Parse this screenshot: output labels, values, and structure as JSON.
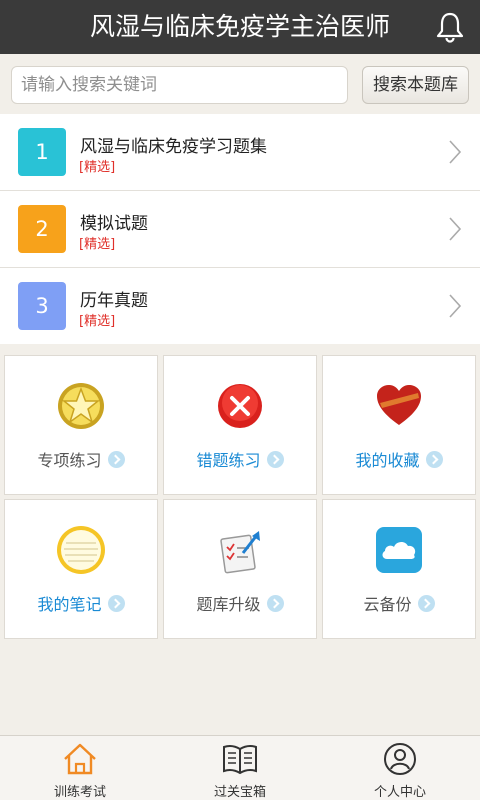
{
  "header": {
    "title": "风湿与临床免疫学主治医师",
    "bell_icon": "bell-icon"
  },
  "search": {
    "placeholder": "请输入搜索关键词",
    "button_label": "搜索本题库"
  },
  "list": {
    "items": [
      {
        "number": "1",
        "name": "风湿与临床免疫学习题集",
        "tag": "[精选]",
        "color": "#29c2d6"
      },
      {
        "number": "2",
        "name": "模拟试题",
        "tag": "[精选]",
        "color": "#f7a21b"
      },
      {
        "number": "3",
        "name": "历年真题",
        "tag": "[精选]",
        "color": "#7f9ff5"
      }
    ]
  },
  "grid": {
    "cells": [
      {
        "label": "专项练习",
        "icon": "star-badge-icon",
        "highlight": false
      },
      {
        "label": "错题练习",
        "icon": "wrong-x-icon",
        "highlight": true
      },
      {
        "label": "我的收藏",
        "icon": "heart-icon",
        "highlight": true
      },
      {
        "label": "我的笔记",
        "icon": "notepad-icon",
        "highlight": true
      },
      {
        "label": "题库升级",
        "icon": "upgrade-icon",
        "highlight": false
      },
      {
        "label": "云备份",
        "icon": "cloud-icon",
        "highlight": false
      }
    ]
  },
  "tabbar": {
    "tabs": [
      {
        "label": "训练考试",
        "icon": "home-icon",
        "active": true
      },
      {
        "label": "过关宝箱",
        "icon": "book-icon",
        "active": false
      },
      {
        "label": "个人中心",
        "icon": "user-icon",
        "active": false
      }
    ]
  },
  "colors": {
    "header_bg": "#3a3a3a",
    "accent_blue": "#1a8ad4",
    "active_tab": "#f08a24",
    "tag_red": "#e0302a"
  }
}
